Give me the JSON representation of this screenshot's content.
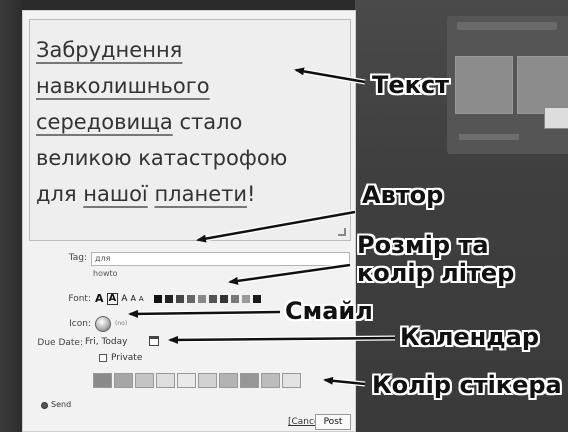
{
  "sticker_text": {
    "line1": "Забруднення",
    "line2": "навколишнього",
    "line3_word": "середовища",
    "line3_rest": " стало",
    "line4": "великою катастрофою",
    "line5_a": "для ",
    "line5_b": "нашої",
    "line5_c": " ",
    "line5_d": "планети",
    "line5_e": "!"
  },
  "form": {
    "tag_label": "Tag:",
    "tag_value": "для",
    "tag_hint": "howto",
    "font_label": "Font:",
    "font_sizes": [
      "A",
      "A",
      "A",
      "A",
      "A"
    ],
    "font_colors": [
      "#111111",
      "#222222",
      "#444444",
      "#666666",
      "#888888",
      "#555555",
      "#333333",
      "#777777",
      "#999999",
      "#1a1a1a"
    ],
    "icon_label": "Icon:",
    "icon_hint": "(no)",
    "due_label": "Due Date:",
    "due_value": "Fri, Today",
    "private_label": "Private",
    "sticker_colors": [
      "#8a8a8a",
      "#a6a6a6",
      "#c4c4c4",
      "#dedede",
      "#e9e9e9",
      "#d2d2d2",
      "#b3b3b3",
      "#969696",
      "#bcbcbc",
      "#e3e3e3"
    ],
    "send_label": "Send",
    "cancel_label": "[Cancel]",
    "post_label": "Post"
  },
  "annotations": {
    "text": "Текст",
    "author": "Автор",
    "size_color_1": "Розмір та",
    "size_color_2": "колір літер",
    "smile": "Смайл",
    "calendar": "Календар",
    "sticker_color": "Колір стікера"
  }
}
